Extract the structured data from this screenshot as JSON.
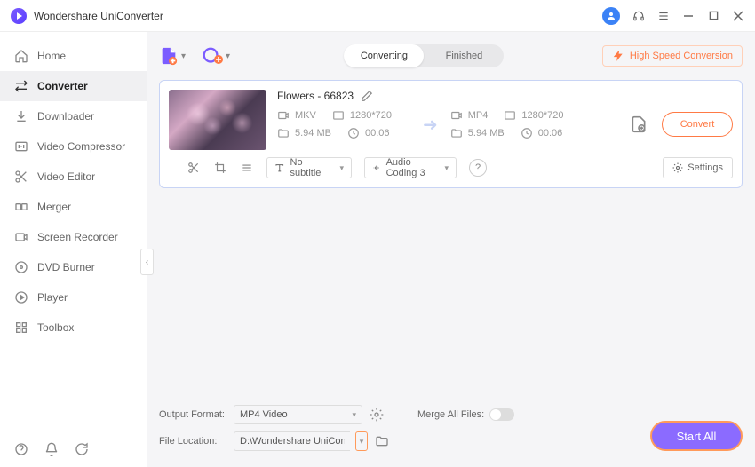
{
  "app": {
    "title": "Wondershare UniConverter"
  },
  "sidebar": {
    "items": [
      {
        "label": "Home"
      },
      {
        "label": "Converter"
      },
      {
        "label": "Downloader"
      },
      {
        "label": "Video Compressor"
      },
      {
        "label": "Video Editor"
      },
      {
        "label": "Merger"
      },
      {
        "label": "Screen Recorder"
      },
      {
        "label": "DVD Burner"
      },
      {
        "label": "Player"
      },
      {
        "label": "Toolbox"
      }
    ]
  },
  "toolbar": {
    "tabs": {
      "converting": "Converting",
      "finished": "Finished"
    },
    "high_speed": "High Speed Conversion"
  },
  "file": {
    "name": "Flowers - 66823",
    "src": {
      "format": "MKV",
      "res": "1280*720",
      "size": "5.94 MB",
      "dur": "00:06"
    },
    "dst": {
      "format": "MP4",
      "res": "1280*720",
      "size": "5.94 MB",
      "dur": "00:06"
    },
    "subtitle": "No subtitle",
    "audio": "Audio Coding 3",
    "settings": "Settings",
    "convert": "Convert"
  },
  "bottom": {
    "output_format_label": "Output Format:",
    "output_format_value": "MP4 Video",
    "file_location_label": "File Location:",
    "file_location_value": "D:\\Wondershare UniConverter",
    "merge_label": "Merge All Files:",
    "start_all": "Start All"
  }
}
